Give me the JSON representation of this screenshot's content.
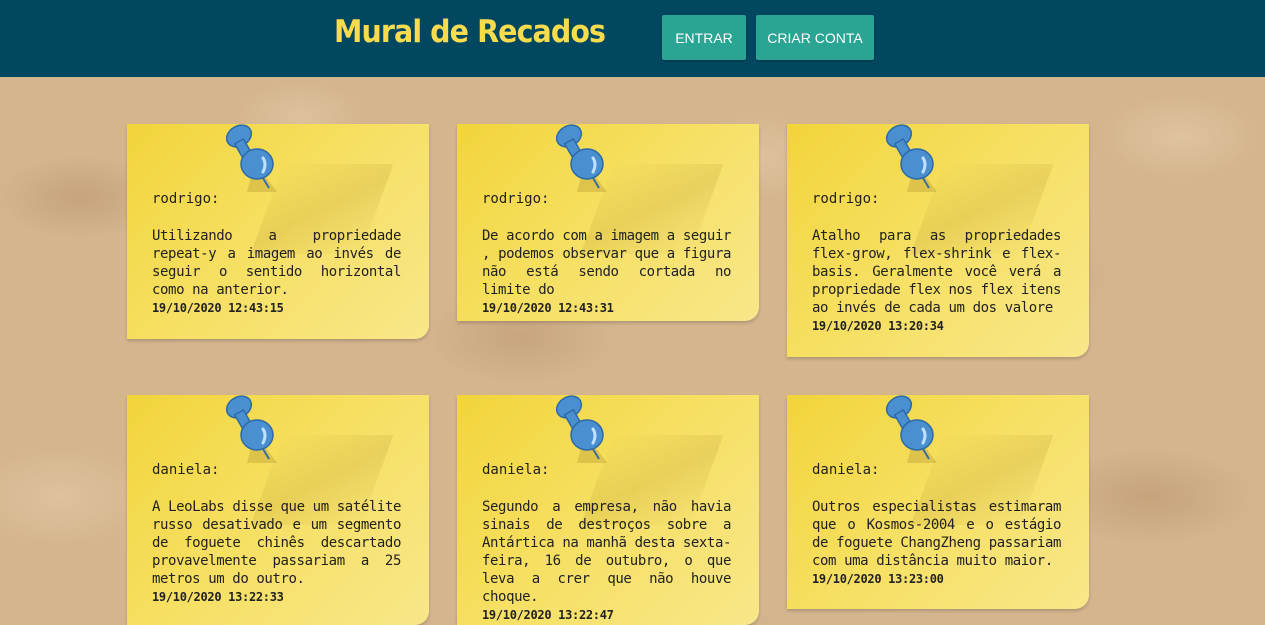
{
  "header": {
    "title": "Mural de Recados",
    "login_label": "ENTRAR",
    "signup_label": "CRIAR CONTA"
  },
  "notes": [
    {
      "author": "rodrigo:",
      "text": "Utilizando a propriedade repeat-y a imagem ao invés de seguir o sentido horizontal como na anterior.",
      "time": "19/10/2020 12:43:15"
    },
    {
      "author": "rodrigo:",
      "text": "De acordo com a imagem a seguir , podemos observar que a figura não está sendo cortada no limite do",
      "time": "19/10/2020 12:43:31"
    },
    {
      "author": "rodrigo:",
      "text": "Atalho para as propriedades flex-grow, flex-shrink e flex-basis. Geralmente você verá a propriedade flex nos flex itens ao invés de cada um dos valore",
      "time": "19/10/2020 13:20:34"
    },
    {
      "author": "daniela:",
      "text": "A LeoLabs disse que um satélite russo desativado e um segmento de foguete chinês descartado provavelmente passariam a 25 metros um do outro.",
      "time": "19/10/2020 13:22:33"
    },
    {
      "author": "daniela:",
      "text": "Segundo a empresa, não havia sinais de destroços sobre a Antártica na manhã desta sexta-feira, 16 de outubro, o que leva a crer que não houve choque.",
      "time": "19/10/2020 13:22:47"
    },
    {
      "author": "daniela:",
      "text": "Outros especialistas estimaram que o Kosmos-2004 e o estágio de foguete ChangZheng passariam com uma distância muito maior.",
      "time": "19/10/2020 13:23:00"
    }
  ],
  "colors": {
    "header_bg": "#01475f",
    "brand": "#f8dc4e",
    "button": "#2aa493",
    "note": "#f4d94a",
    "pin": "#4a8fd0"
  },
  "icons": {
    "pin": "push-pin-icon"
  }
}
